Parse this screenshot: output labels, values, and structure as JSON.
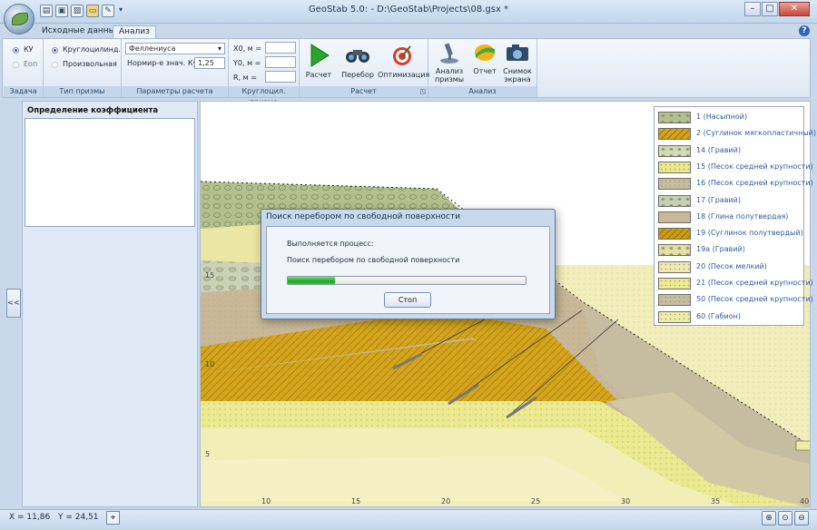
{
  "window": {
    "title": "GeoStab 5.0: - D:\\GeoStab\\Projects\\08.gsx *",
    "minimize": "–",
    "maximize": "□",
    "close": "✕"
  },
  "quick_access": [
    "new-file-icon",
    "save-icon",
    "save-as-icon",
    "open-folder-icon",
    "tools-icon"
  ],
  "tabs": [
    {
      "label": "Исходные данные",
      "active": false
    },
    {
      "label": "Анализ",
      "active": true
    }
  ],
  "help": "?",
  "ribbon": {
    "task": {
      "label": "Задача",
      "ku": "КУ",
      "eop": "Еоп"
    },
    "prism_type": {
      "label": "Тип призмы",
      "circular": "Круглоцилинд.",
      "arbitrary": "Произвольная"
    },
    "calc_params": {
      "label": "Параметры расчета",
      "method": "Феллениуса",
      "norm_label": "Нормир-е знач. Ку",
      "norm_value": "1,25"
    },
    "circular_prism": {
      "label": "Круглоцил. призма",
      "x0": "X0, м =",
      "y0": "Y0, м =",
      "r": "R, м ="
    },
    "calc": {
      "label": "Расчет",
      "run": "Расчет",
      "search": "Перебор",
      "optimize": "Оптимизация"
    },
    "analysis": {
      "label": "Анализ",
      "prism_analysis_1": "Анализ",
      "prism_analysis_2": "призмы",
      "report": "Отчет",
      "snapshot_1": "Снимок",
      "snapshot_2": "экрана"
    }
  },
  "left_panel": {
    "title": "Определение коэффициента устойчивости",
    "collapse": "<<"
  },
  "axis": {
    "y_ticks": [
      "15",
      "10",
      "5"
    ],
    "x_ticks": [
      "10",
      "15",
      "20",
      "25",
      "30",
      "35",
      "40"
    ]
  },
  "legend": [
    {
      "label": "1 (Насыпной)",
      "color": "#b4c08c",
      "pattern": "circles"
    },
    {
      "label": "2 (Суглинок мягкопластичный)",
      "color": "#d4a41c",
      "pattern": "hatch"
    },
    {
      "label": "14 (Гравий)",
      "color": "#d2dcb4",
      "pattern": "circles-light"
    },
    {
      "label": "15 (Песок средней крупности)",
      "color": "#ece88a",
      "pattern": "dots"
    },
    {
      "label": "16 (Песок средней крупности)",
      "color": "#c4bea0",
      "pattern": "dots"
    },
    {
      "label": "17 (Гравий)",
      "color": "#c8d0b4",
      "pattern": "circles"
    },
    {
      "label": "18 (Глина полутвердая)",
      "color": "#c8b898",
      "pattern": "plain"
    },
    {
      "label": "19 (Суглинок полутвердый)",
      "color": "#cc9c10",
      "pattern": "hatch"
    },
    {
      "label": "19а (Гравий)",
      "color": "#e6e0a0",
      "pattern": "circles"
    },
    {
      "label": "20 (Песок мелкий)",
      "color": "#f0eab0",
      "pattern": "dots"
    },
    {
      "label": "21 (Песок средней крупности)",
      "color": "#ecea90",
      "pattern": "dots"
    },
    {
      "label": "50 (Песок средней крупности)",
      "color": "#c6bca0",
      "pattern": "dots"
    },
    {
      "label": "60 (Габион)",
      "color": "#f0eca8",
      "pattern": "dots"
    }
  ],
  "dialog": {
    "title": "Поиск перебором по свободной поверхности",
    "process_label": "Выполняется процесс:",
    "process_name": "Поиск перебором по свободной поверхности",
    "progress": 0.2,
    "stop": "Стоп"
  },
  "status": {
    "x": "X = 11,86",
    "y": "Y = 24,51"
  }
}
